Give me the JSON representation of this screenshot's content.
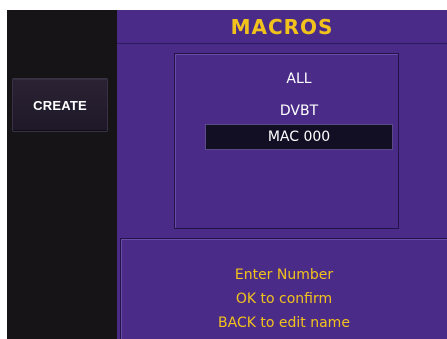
{
  "sidebar": {
    "create_label": "CREATE"
  },
  "header": {
    "title": "MACROS"
  },
  "macro_list": {
    "items": [
      {
        "label": "ALL",
        "selected": false
      },
      {
        "label": "DVBT",
        "selected": false
      },
      {
        "label": "MAC 000",
        "selected": true
      }
    ]
  },
  "info": {
    "lines": [
      "Enter Number",
      "OK to confirm",
      "BACK to edit name"
    ]
  },
  "colors": {
    "panel_background": "#4a2c88",
    "title_text": "#f2c21c",
    "info_text": "#f2c21c",
    "list_text": "#ffffff",
    "selected_background": "#120e24",
    "left_panel": "#161416"
  }
}
